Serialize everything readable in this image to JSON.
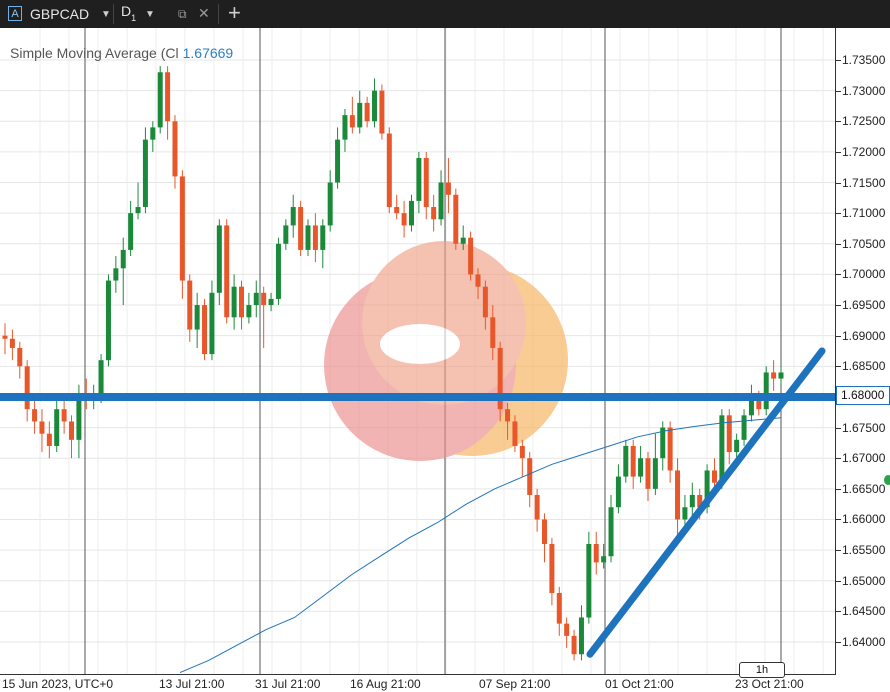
{
  "tab": {
    "symbol": "GBPCAD",
    "symbol_icon": "A",
    "timeframe": "D",
    "timeframe_sub": "1"
  },
  "indicator": {
    "name": "Simple Moving Average (Cl",
    "value": "1.67669"
  },
  "price_tag": "1.68000",
  "timeframe_box": "1h",
  "colors": {
    "up": "#1a8a3a",
    "down": "#e8572a",
    "hline": "#1d73be",
    "sma": "#1d73be"
  },
  "chart_data": {
    "type": "candlestick",
    "title": "",
    "y_ticks": [
      "1.73500",
      "1.73000",
      "1.72500",
      "1.72000",
      "1.71500",
      "1.71000",
      "1.70500",
      "1.70000",
      "1.69500",
      "1.69000",
      "1.68500",
      "1.68000",
      "1.67500",
      "1.67000",
      "1.66500",
      "1.66000",
      "1.65500",
      "1.65000",
      "1.64500",
      "1.64000"
    ],
    "x_ticks": [
      "15 Jun 2023, UTC+0",
      "13 Jul 21:00",
      "31 Jul 21:00",
      "16 Aug 21:00",
      "07 Sep 21:00",
      "01 Oct 21:00",
      "23 Oct 21:00"
    ],
    "ylim": [
      1.637,
      1.739
    ],
    "grid": true,
    "horizontal_line": 1.68,
    "candles": [
      [
        1.69,
        1.6895,
        1.692,
        1.687
      ],
      [
        1.6895,
        1.688,
        1.691,
        1.686
      ],
      [
        1.688,
        1.685,
        1.689,
        1.683
      ],
      [
        1.685,
        1.678,
        1.686,
        1.676
      ],
      [
        1.678,
        1.676,
        1.68,
        1.674
      ],
      [
        1.676,
        1.674,
        1.678,
        1.671
      ],
      [
        1.674,
        1.672,
        1.676,
        1.67
      ],
      [
        1.672,
        1.678,
        1.68,
        1.671
      ],
      [
        1.678,
        1.676,
        1.68,
        1.674
      ],
      [
        1.676,
        1.673,
        1.677,
        1.67
      ],
      [
        1.673,
        1.68,
        1.682,
        1.67
      ],
      [
        1.68,
        1.6795,
        1.683,
        1.678
      ],
      [
        1.6795,
        1.68,
        1.682,
        1.678
      ],
      [
        1.68,
        1.686,
        1.687,
        1.679
      ],
      [
        1.686,
        1.699,
        1.7,
        1.685
      ],
      [
        1.699,
        1.701,
        1.703,
        1.697
      ],
      [
        1.701,
        1.704,
        1.706,
        1.695
      ],
      [
        1.704,
        1.71,
        1.712,
        1.703
      ],
      [
        1.71,
        1.711,
        1.715,
        1.709
      ],
      [
        1.711,
        1.722,
        1.724,
        1.71
      ],
      [
        1.722,
        1.724,
        1.725,
        1.72
      ],
      [
        1.724,
        1.733,
        1.734,
        1.723
      ],
      [
        1.733,
        1.725,
        1.734,
        1.722
      ],
      [
        1.725,
        1.716,
        1.726,
        1.714
      ],
      [
        1.716,
        1.699,
        1.717,
        1.696
      ],
      [
        1.699,
        1.691,
        1.7,
        1.689
      ],
      [
        1.691,
        1.695,
        1.697,
        1.688
      ],
      [
        1.695,
        1.687,
        1.696,
        1.686
      ],
      [
        1.687,
        1.697,
        1.699,
        1.686
      ],
      [
        1.697,
        1.708,
        1.709,
        1.695
      ],
      [
        1.708,
        1.693,
        1.709,
        1.692
      ],
      [
        1.693,
        1.698,
        1.7,
        1.691
      ],
      [
        1.698,
        1.693,
        1.699,
        1.691
      ],
      [
        1.693,
        1.695,
        1.697,
        1.692
      ],
      [
        1.695,
        1.697,
        1.699,
        1.693
      ],
      [
        1.697,
        1.695,
        1.698,
        1.688
      ],
      [
        1.695,
        1.696,
        1.697,
        1.694
      ],
      [
        1.696,
        1.705,
        1.706,
        1.695
      ],
      [
        1.705,
        1.708,
        1.709,
        1.704
      ],
      [
        1.708,
        1.711,
        1.713,
        1.706
      ],
      [
        1.711,
        1.704,
        1.712,
        1.703
      ],
      [
        1.704,
        1.708,
        1.709,
        1.703
      ],
      [
        1.708,
        1.704,
        1.71,
        1.702
      ],
      [
        1.704,
        1.708,
        1.709,
        1.701
      ],
      [
        1.708,
        1.715,
        1.717,
        1.707
      ],
      [
        1.715,
        1.722,
        1.724,
        1.714
      ],
      [
        1.722,
        1.726,
        1.727,
        1.72
      ],
      [
        1.726,
        1.724,
        1.729,
        1.723
      ],
      [
        1.724,
        1.728,
        1.73,
        1.723
      ],
      [
        1.728,
        1.725,
        1.729,
        1.724
      ],
      [
        1.725,
        1.73,
        1.732,
        1.724
      ],
      [
        1.73,
        1.723,
        1.731,
        1.722
      ],
      [
        1.723,
        1.711,
        1.724,
        1.71
      ],
      [
        1.711,
        1.71,
        1.713,
        1.709
      ],
      [
        1.71,
        1.708,
        1.712,
        1.706
      ],
      [
        1.708,
        1.712,
        1.713,
        1.707
      ],
      [
        1.712,
        1.719,
        1.72,
        1.71
      ],
      [
        1.719,
        1.711,
        1.72,
        1.709
      ],
      [
        1.711,
        1.709,
        1.713,
        1.707
      ],
      [
        1.709,
        1.715,
        1.717,
        1.708
      ],
      [
        1.715,
        1.713,
        1.719,
        1.71
      ],
      [
        1.713,
        1.705,
        1.714,
        1.704
      ],
      [
        1.705,
        1.706,
        1.708,
        1.704
      ],
      [
        1.706,
        1.7,
        1.707,
        1.699
      ],
      [
        1.7,
        1.698,
        1.701,
        1.696
      ],
      [
        1.698,
        1.693,
        1.699,
        1.691
      ],
      [
        1.693,
        1.688,
        1.695,
        1.686
      ],
      [
        1.688,
        1.678,
        1.689,
        1.676
      ],
      [
        1.678,
        1.676,
        1.679,
        1.673
      ],
      [
        1.676,
        1.672,
        1.677,
        1.671
      ],
      [
        1.672,
        1.67,
        1.673,
        1.667
      ],
      [
        1.67,
        1.664,
        1.671,
        1.662
      ],
      [
        1.664,
        1.66,
        1.665,
        1.658
      ],
      [
        1.66,
        1.656,
        1.661,
        1.653
      ],
      [
        1.656,
        1.648,
        1.657,
        1.646
      ],
      [
        1.648,
        1.643,
        1.649,
        1.641
      ],
      [
        1.643,
        1.641,
        1.644,
        1.639
      ],
      [
        1.641,
        1.638,
        1.642,
        1.637
      ],
      [
        1.638,
        1.644,
        1.646,
        1.637
      ],
      [
        1.644,
        1.656,
        1.658,
        1.643
      ],
      [
        1.656,
        1.653,
        1.658,
        1.651
      ],
      [
        1.653,
        1.654,
        1.656,
        1.652
      ],
      [
        1.654,
        1.662,
        1.664,
        1.653
      ],
      [
        1.662,
        1.667,
        1.669,
        1.661
      ],
      [
        1.667,
        1.672,
        1.673,
        1.666
      ],
      [
        1.672,
        1.667,
        1.673,
        1.665
      ],
      [
        1.667,
        1.67,
        1.672,
        1.666
      ],
      [
        1.67,
        1.665,
        1.671,
        1.663
      ],
      [
        1.665,
        1.67,
        1.674,
        1.664
      ],
      [
        1.67,
        1.675,
        1.676,
        1.668
      ],
      [
        1.675,
        1.668,
        1.676,
        1.666
      ],
      [
        1.668,
        1.66,
        1.67,
        1.657
      ],
      [
        1.66,
        1.662,
        1.664,
        1.658
      ],
      [
        1.662,
        1.664,
        1.666,
        1.66
      ],
      [
        1.664,
        1.662,
        1.665,
        1.66
      ],
      [
        1.662,
        1.668,
        1.669,
        1.661
      ],
      [
        1.668,
        1.666,
        1.67,
        1.664
      ],
      [
        1.666,
        1.677,
        1.678,
        1.665
      ],
      [
        1.677,
        1.671,
        1.678,
        1.669
      ],
      [
        1.671,
        1.673,
        1.674,
        1.67
      ],
      [
        1.673,
        1.677,
        1.678,
        1.672
      ],
      [
        1.677,
        1.68,
        1.682,
        1.676
      ],
      [
        1.68,
        1.678,
        1.681,
        1.677
      ],
      [
        1.678,
        1.684,
        1.685,
        1.677
      ],
      [
        1.684,
        1.683,
        1.686,
        1.681
      ],
      [
        1.683,
        1.684,
        1.685,
        1.682
      ]
    ],
    "sma_values": [
      1.635,
      1.637,
      1.6395,
      1.642,
      1.644,
      1.6475,
      1.651,
      1.654,
      1.657,
      1.6595,
      1.6625,
      1.665,
      1.667,
      1.669,
      1.6705,
      1.672,
      1.6735,
      1.6745,
      1.6752,
      1.6758,
      1.6762,
      1.6766
    ],
    "trendline": {
      "from": [
        1.638,
        1.638
      ],
      "to": [
        1.6875,
        1.6875
      ]
    }
  }
}
